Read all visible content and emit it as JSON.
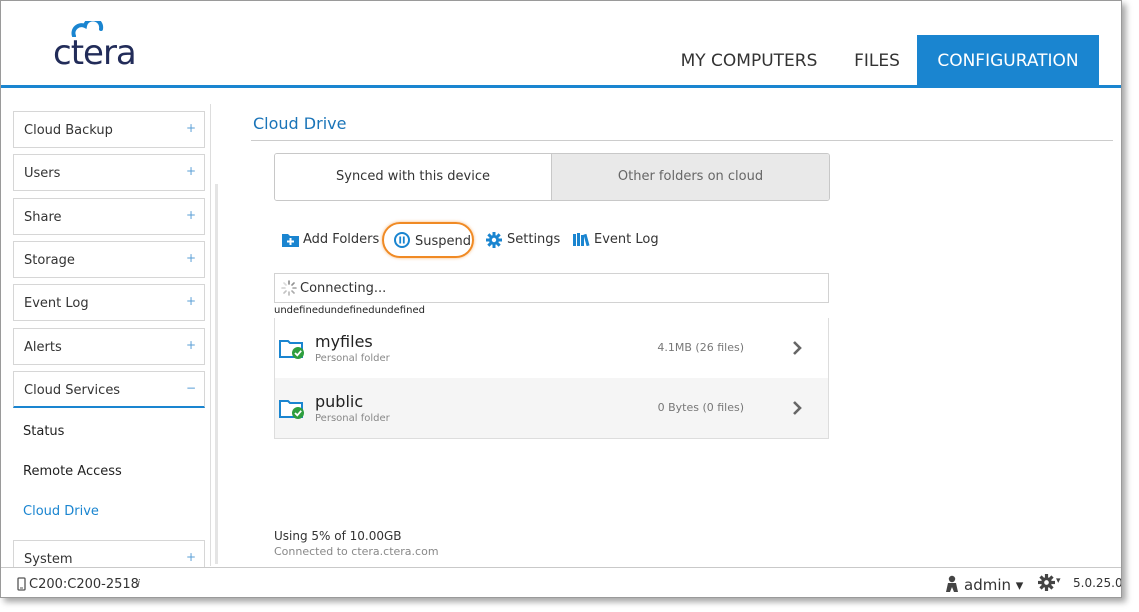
{
  "header": {
    "logo_text": "ctera",
    "tabs": [
      {
        "label": "MY COMPUTERS",
        "active": false
      },
      {
        "label": "FILES",
        "active": false
      },
      {
        "label": "CONFIGURATION",
        "active": true
      }
    ]
  },
  "sidebar": {
    "items": [
      {
        "label": "Cloud Backup",
        "toggle": "+"
      },
      {
        "label": "Users",
        "toggle": "+"
      },
      {
        "label": "Share",
        "toggle": "+"
      },
      {
        "label": "Storage",
        "toggle": "+"
      },
      {
        "label": "Event Log",
        "toggle": "+"
      },
      {
        "label": "Alerts",
        "toggle": "+"
      },
      {
        "label": "Cloud Services",
        "toggle": "−"
      }
    ],
    "sub_items": [
      {
        "label": "Status"
      },
      {
        "label": "Remote Access"
      },
      {
        "label": "Cloud Drive",
        "selected": true
      }
    ],
    "system": {
      "label": "System",
      "toggle": "+"
    }
  },
  "main": {
    "title": "Cloud Drive",
    "segments": {
      "synced": "Synced with this device",
      "other": "Other folders on cloud"
    },
    "toolbar": {
      "add_folders": "Add Folders",
      "suspend": "Suspend",
      "settings": "Settings",
      "event_log": "Event Log"
    },
    "status": "Connecting...",
    "debug_text": "undefinedundefinedundefined",
    "folders": [
      {
        "name": "myfiles",
        "type": "Personal folder",
        "size": "4.1MB (26 files)"
      },
      {
        "name": "public",
        "type": "Personal folder",
        "size": "0 Bytes (0 files)"
      }
    ],
    "usage": "Using 5% of 10.00GB",
    "connected": "Connected to ctera.ctera.com"
  },
  "footer": {
    "device": "C200:C200-2518",
    "info_glyph": "i",
    "user": "admin ▾",
    "gear_caret": "▾",
    "version": "5.0.25.0"
  },
  "colors": {
    "accent": "#1a85d0",
    "highlight_ring": "#f08a24",
    "sync_ok": "#2e9e3e"
  },
  "icons": [
    "add-folder-icon",
    "pause-icon",
    "gear-icon",
    "event-log-icon",
    "spinner-icon",
    "folder-synced-icon",
    "chevron-right-icon",
    "device-icon",
    "user-icon"
  ]
}
